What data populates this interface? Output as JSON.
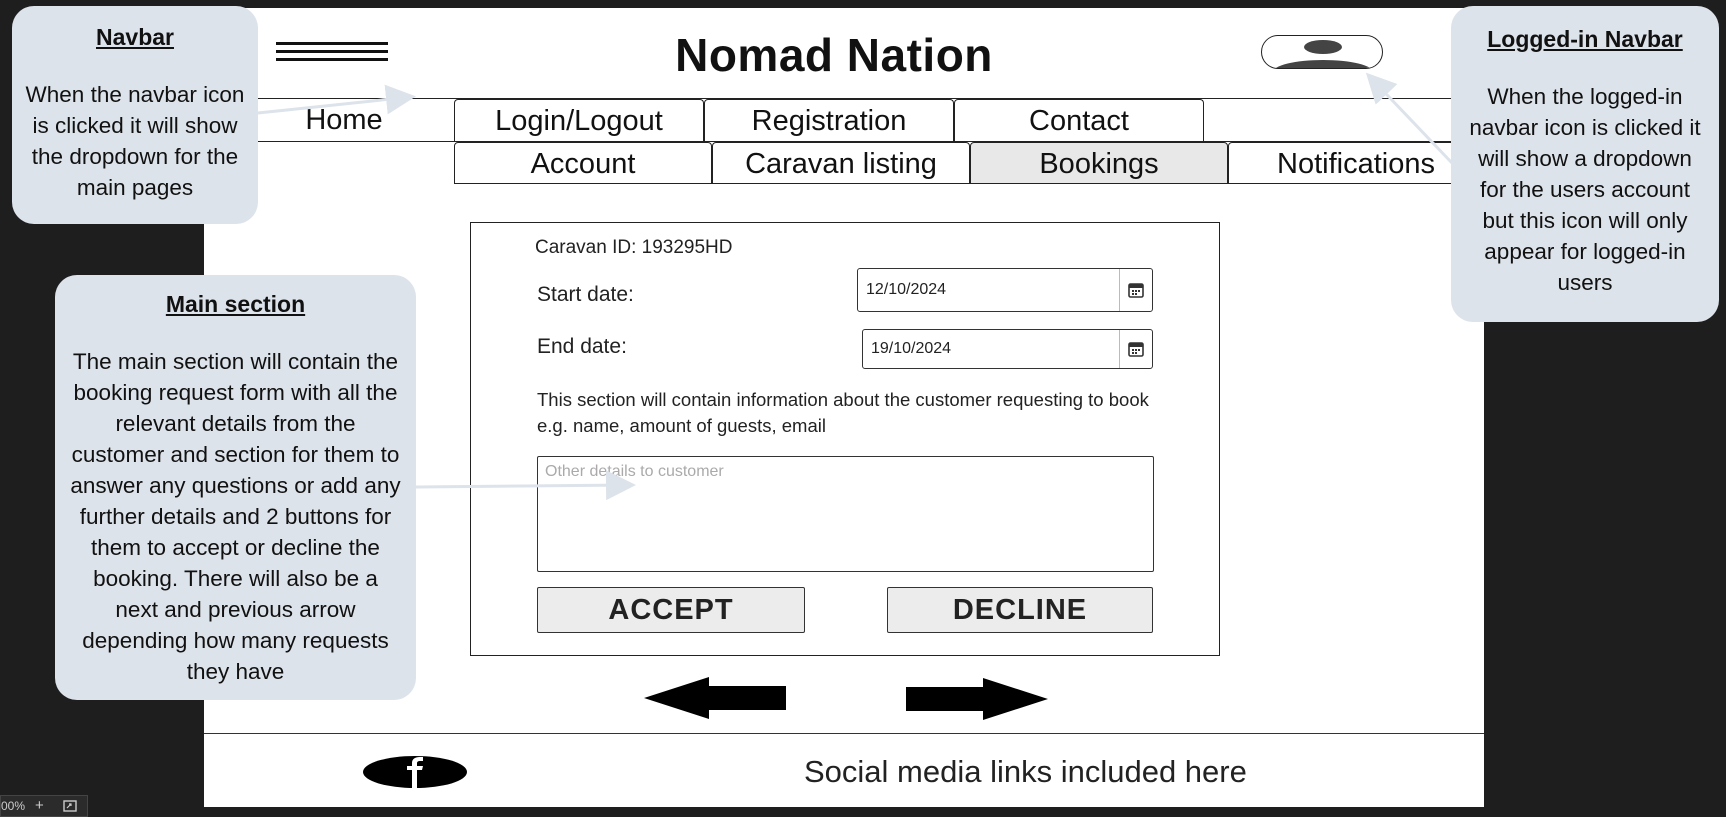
{
  "header": {
    "title": "Nomad Nation"
  },
  "nav": {
    "row1": [
      "Home",
      "Login/Logout",
      "Registration",
      "Contact"
    ],
    "row2": [
      "Account",
      "Caravan listing",
      "Bookings",
      "Notifications"
    ],
    "active": "Bookings"
  },
  "form": {
    "caravan_id": "Caravan ID: 193295HD",
    "start_label": "Start date:",
    "start_value": "12/10/2024",
    "end_label": "End date:",
    "end_value": "19/10/2024",
    "info_text": "This section will contain information about the customer requesting to book e.g. name, amount of guests, email",
    "details_placeholder": "Other details to customer",
    "accept_label": "ACCEPT",
    "decline_label": "DECLINE"
  },
  "footer": {
    "text": "Social media links included here"
  },
  "annotations": {
    "navbar": {
      "title": "Navbar",
      "body": "When the navbar icon is clicked it will show the dropdown for the main pages"
    },
    "logged_in": {
      "title": "Logged-in Navbar",
      "body": "When the logged-in navbar icon is clicked it will show a dropdown for the users account but this icon will only appear for logged-in users"
    },
    "main_section": {
      "title": "Main section",
      "body": "The main section will contain the booking request form with all the relevant details from the customer and section for them to answer any questions or add any further details and 2 buttons for them to accept or decline the booking. There will also be a next and previous arrow depending how many requests they have"
    }
  },
  "toolbar": {
    "zoom": "00%",
    "plus": "+"
  },
  "colors": {
    "canvas": "#1e1e1e",
    "note_bg": "#dde3ea",
    "active_tab": "#e8e8e8",
    "button_bg": "#ececec"
  },
  "icons": [
    "hamburger-icon",
    "user-icon",
    "calendar-icon",
    "left-arrow-icon",
    "right-arrow-icon",
    "facebook-icon",
    "fit-screen-icon"
  ]
}
